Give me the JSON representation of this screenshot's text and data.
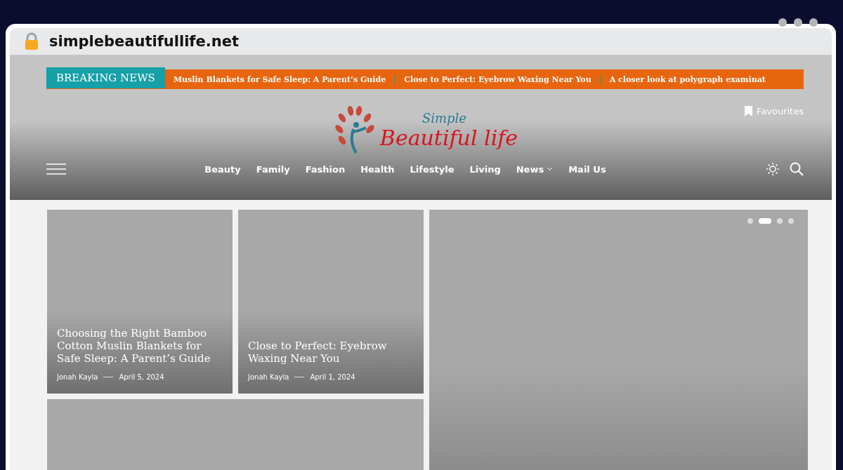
{
  "browser": {
    "url": "simplebeautifullife.net"
  },
  "ticker": {
    "label": "BREAKING NEWS",
    "items": [
      "Muslin Blankets for Safe Sleep: A Parent’s Guide",
      "Close to Perfect: Eyebrow Waxing Near You",
      "A closer look at polygraph examinat"
    ]
  },
  "header": {
    "logo_top": "Simple",
    "logo_bottom": "Beautiful life",
    "favourites": "Favourites"
  },
  "nav": [
    {
      "label": "Beauty",
      "dropdown": false
    },
    {
      "label": "Family",
      "dropdown": false
    },
    {
      "label": "Fashion",
      "dropdown": false
    },
    {
      "label": "Health",
      "dropdown": false
    },
    {
      "label": "Lifestyle",
      "dropdown": false
    },
    {
      "label": "Living",
      "dropdown": false
    },
    {
      "label": "News",
      "dropdown": true
    },
    {
      "label": "Mail Us",
      "dropdown": false
    }
  ],
  "posts": [
    {
      "title": "Choosing the Right Bamboo Cotton Muslin Blankets for Safe Sleep: A Parent’s Guide",
      "author": "Jonah Kayla",
      "date": "April 5, 2024"
    },
    {
      "title": "Close to Perfect: Eyebrow Waxing Near You",
      "author": "Jonah Kayla",
      "date": "April 1, 2024"
    }
  ],
  "slider": {
    "dots": [
      {
        "selected": false
      },
      {
        "selected": true
      },
      {
        "selected": false
      },
      {
        "selected": false
      }
    ]
  }
}
